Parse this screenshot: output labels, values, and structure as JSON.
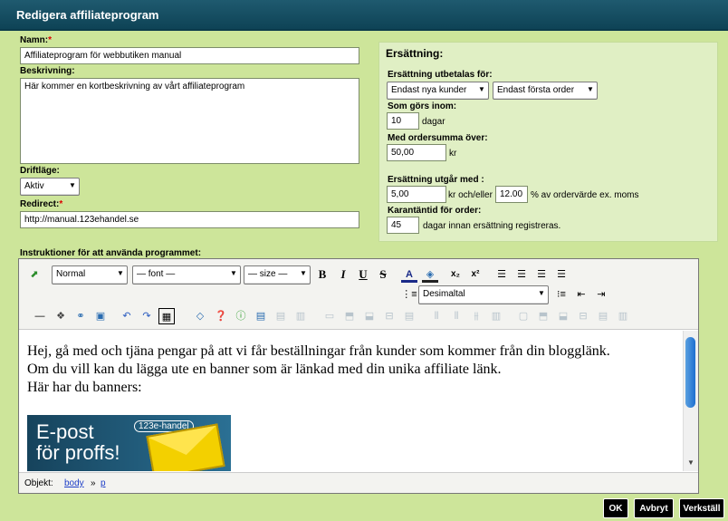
{
  "window": {
    "title": "Redigera affiliateprogram"
  },
  "form": {
    "name_label": "Namn:",
    "name_value": "Affiliateprogram för webbutiken manual",
    "description_label": "Beskrivning:",
    "description_value": "Här kommer en kortbeskrivning av vårt affiliateprogram",
    "status_label": "Driftläge:",
    "status_value": "Aktiv",
    "redirect_label": "Redirect:",
    "redirect_value": "http://manual.123ehandel.se",
    "required_mark": "*"
  },
  "compensation": {
    "title": "Ersättning:",
    "paid_for_label": "Ersättning utbetalas för:",
    "customer_select": "Endast nya kunder",
    "order_select": "Endast första order",
    "within_label": "Som görs inom:",
    "within_value": "10",
    "within_unit": "dagar",
    "min_sum_label": "Med ordersumma över:",
    "min_sum_value": "50,00",
    "min_sum_unit": "kr",
    "amount_label": "Ersättning utgår med :",
    "amount_kr": "5,00",
    "amount_kr_unit": "kr och/eller",
    "amount_pct": "12.00",
    "amount_pct_unit": "% av ordervärde ex. moms",
    "quarantine_label": "Karantäntid för order:",
    "quarantine_value": "45",
    "quarantine_unit": "dagar innan ersättning registreras."
  },
  "instructions": {
    "label": "Instruktioner för att använda programmet:",
    "format_select": "Normal",
    "font_select": "— font —",
    "size_select": "— size —",
    "list_style_select": "Desimaltal",
    "content_lines": [
      "Hej, gå med och tjäna pengar på att vi får beställningar från kunder som kommer från din blogglänk.",
      "Om du vill kan du lägga ute en banner som är länkad med din unika affiliate länk.",
      "Här har du banners:"
    ],
    "banner_line1": "E-post",
    "banner_line2": "för proffs!",
    "banner_logo": "123e-handel",
    "path_label": "Objekt:",
    "path_body": "body",
    "path_sep": "»",
    "path_p": "p"
  },
  "buttons": {
    "ok": "OK",
    "cancel": "Avbryt",
    "apply": "Verkställ"
  }
}
